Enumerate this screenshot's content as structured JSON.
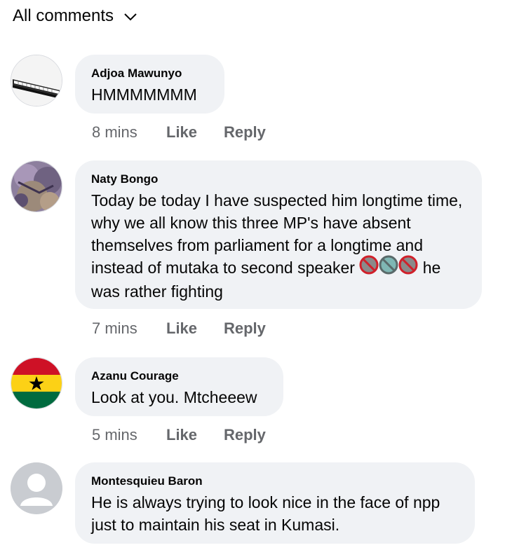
{
  "header": {
    "filter_label": "All comments"
  },
  "comments": [
    {
      "author": "Adjoa Mawunyo",
      "text": "HMMMMMMM",
      "time": "8 mins",
      "like": "Like",
      "reply": "Reply",
      "avatar_icon": "piano-keyboard-photo"
    },
    {
      "author": "Naty Bongo",
      "text_before": "Today be today I have suspected him longtime time, why we all know this three MP's have absent themselves from parliament for a longtime and instead of mutaka to second speaker",
      "text_after": "he was rather fighting",
      "emojis": [
        "prohibited-shoe-icon",
        "prohibited-shoe-teal-icon",
        "prohibited-shoe-icon"
      ],
      "time": "7 mins",
      "like": "Like",
      "reply": "Reply",
      "avatar_icon": "outdoor-photo"
    },
    {
      "author": "Azanu Courage",
      "text": "Look at you. Mtcheeew",
      "time": "5 mins",
      "like": "Like",
      "reply": "Reply",
      "avatar_icon": "ghana-flag-photo",
      "avatar_colors": [
        "#ce1126",
        "#fcd116",
        "#006b3f"
      ]
    },
    {
      "author": "Montesquieu Baron",
      "text": "He is always trying to look nice in the face of npp just to maintain his seat in Kumasi.",
      "avatar_icon": "default-avatar-icon"
    }
  ]
}
